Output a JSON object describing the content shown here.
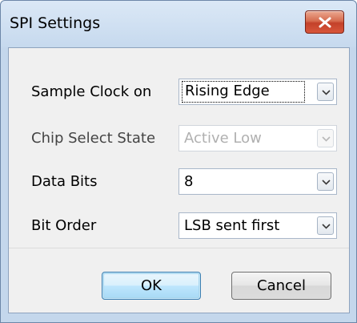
{
  "window": {
    "title": "SPI Settings",
    "close_icon": "close-x-icon"
  },
  "fields": [
    {
      "label": "Sample Clock on",
      "value": "Rising Edge",
      "enabled": true,
      "focused": true
    },
    {
      "label": "Chip Select State",
      "value": "Active Low",
      "enabled": false,
      "focused": false
    },
    {
      "label": "Data Bits",
      "value": "8",
      "enabled": true,
      "focused": false
    },
    {
      "label": "Bit Order",
      "value": "LSB sent first",
      "enabled": true,
      "focused": false
    }
  ],
  "buttons": {
    "ok_label": "OK",
    "cancel_label": "Cancel"
  },
  "colors": {
    "frame": "#c4d7ec",
    "close_button": "#c3412a",
    "default_button_border": "#3c7fb1"
  }
}
